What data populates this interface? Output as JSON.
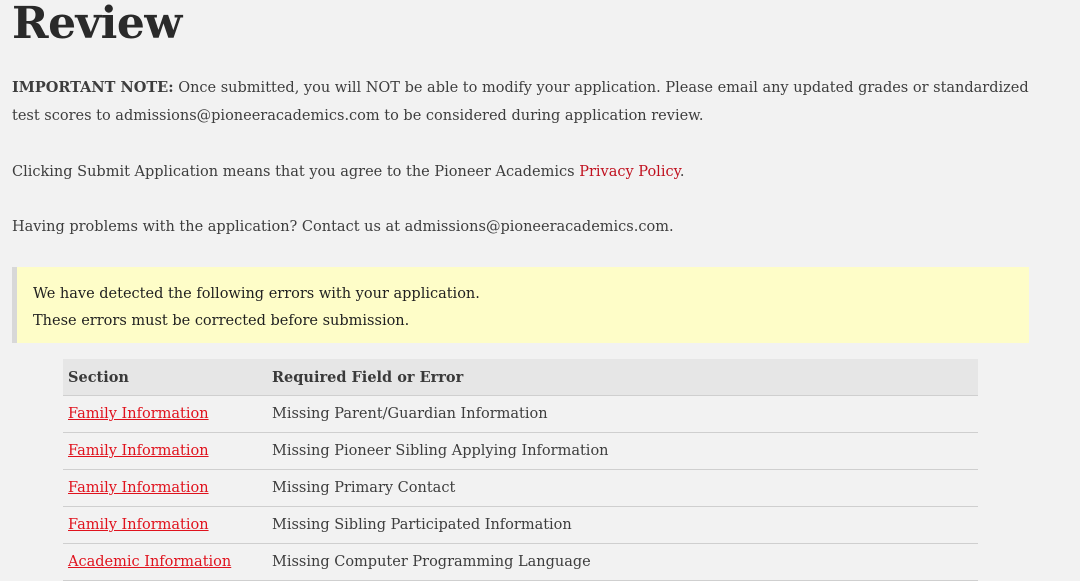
{
  "page_title": "Review",
  "note": {
    "label": "IMPORTANT NOTE:",
    "text": " Once submitted, you will NOT be able to modify your application. Please email any updated grades or standardized test scores to admissions@pioneeracademics.com to be considered during application review."
  },
  "privacy": {
    "before": "Clicking Submit Application means that you agree to the Pioneer Academics ",
    "link": "Privacy Policy",
    "after": "."
  },
  "contact": "Having problems with the application? Contact us at admissions@pioneeracademics.com.",
  "errors_box": {
    "line1": "We have detected the following errors with your application.",
    "line2": "These errors must be corrected before submission."
  },
  "table": {
    "headers": [
      "Section",
      "Required Field or Error"
    ],
    "rows": [
      {
        "section": "Family Information",
        "error": "Missing Parent/Guardian Information"
      },
      {
        "section": "Family Information",
        "error": "Missing Pioneer Sibling Applying Information"
      },
      {
        "section": "Family Information",
        "error": "Missing Primary Contact"
      },
      {
        "section": "Family Information",
        "error": "Missing Sibling Participated Information"
      },
      {
        "section": "Academic Information",
        "error": "Missing Computer Programming Language"
      }
    ]
  },
  "colors": {
    "link": "#e0121d",
    "error_box_bg": "#fefdc8",
    "page_bg": "#f2f2f2"
  }
}
